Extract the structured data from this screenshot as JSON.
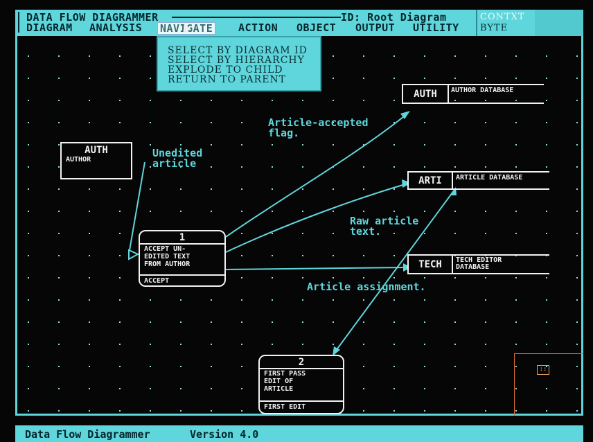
{
  "header": {
    "app_title": "DATA FLOW DIAGRAMMER",
    "diagram_id": "ID: Root Diagram",
    "context_label": "CONTXT",
    "context_value": "BYTE"
  },
  "menu": {
    "items": [
      "DIAGRAM",
      "ANALYSIS",
      "NAVIGATE",
      "ACTION",
      "OBJECT",
      "OUTPUT",
      "UTILITY"
    ]
  },
  "dropdown": {
    "items": [
      "SELECT BY DIAGRAM ID",
      "SELECT BY HIERARCHY",
      "EXPLODE TO CHILD",
      "RETURN TO PARENT"
    ]
  },
  "external_entity": {
    "id": "AUTH",
    "name": "AUTHOR"
  },
  "processes": [
    {
      "number": "1",
      "description": [
        "ACCEPT UN-",
        "EDITED TEXT",
        "FROM AUTHOR"
      ],
      "footer": "ACCEPT"
    },
    {
      "number": "2",
      "description": [
        "FIRST PASS",
        "EDIT OF",
        "ARTICLE"
      ],
      "footer": "FIRST EDIT"
    }
  ],
  "data_stores": [
    {
      "id": "AUTH",
      "name": [
        "AUTHOR DATABASE"
      ]
    },
    {
      "id": "ARTI",
      "name": [
        "ARTICLE DATABASE"
      ]
    },
    {
      "id": "TECH",
      "name": [
        "TECH EDITOR",
        "DATABASE"
      ]
    }
  ],
  "flows": {
    "unedited": [
      "Unedited",
      "article"
    ],
    "accepted": [
      "Article-accepted",
      "flag."
    ],
    "raw": [
      "Raw article",
      "text."
    ],
    "assignment": "Article assignment."
  },
  "minimap": {
    "marker": "::"
  },
  "status": {
    "app_name": "Data Flow Diagrammer",
    "version": "Version 4.0"
  },
  "colors": {
    "accent": "#5fd6dc",
    "background": "#060606",
    "foreground": "#f2f2f2",
    "minimap": "#e07030"
  }
}
